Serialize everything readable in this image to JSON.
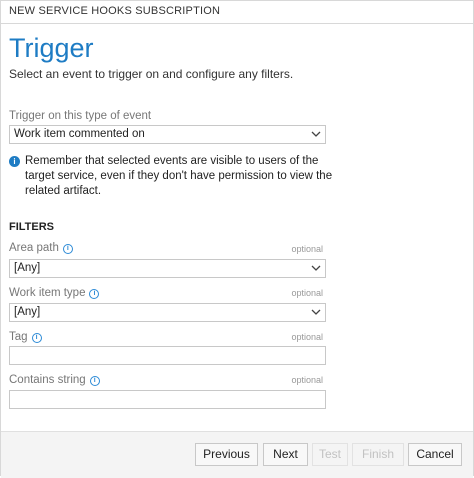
{
  "dialog": {
    "title": "NEW SERVICE HOOKS SUBSCRIPTION",
    "heading": "Trigger",
    "subtitle": "Select an event to trigger on and configure any filters."
  },
  "trigger": {
    "label": "Trigger on this type of event",
    "value": "Work item commented on"
  },
  "notice": {
    "text": "Remember that selected events are visible to users of the target service, even if they don't have permission to view the related artifact."
  },
  "filters": {
    "heading": "FILTERS",
    "optional_label": "optional",
    "area_path": {
      "label": "Area path",
      "value": "[Any]"
    },
    "work_item_type": {
      "label": "Work item type",
      "value": "[Any]"
    },
    "tag": {
      "label": "Tag",
      "value": ""
    },
    "contains_string": {
      "label": "Contains string",
      "value": ""
    }
  },
  "buttons": {
    "previous": "Previous",
    "next": "Next",
    "test": "Test",
    "finish": "Finish",
    "cancel": "Cancel"
  },
  "icons": {
    "info": "info-icon",
    "chevron": "chevron-down-icon"
  },
  "colors": {
    "accent": "#1e7cc4",
    "disabled": "#c2c2c2"
  }
}
